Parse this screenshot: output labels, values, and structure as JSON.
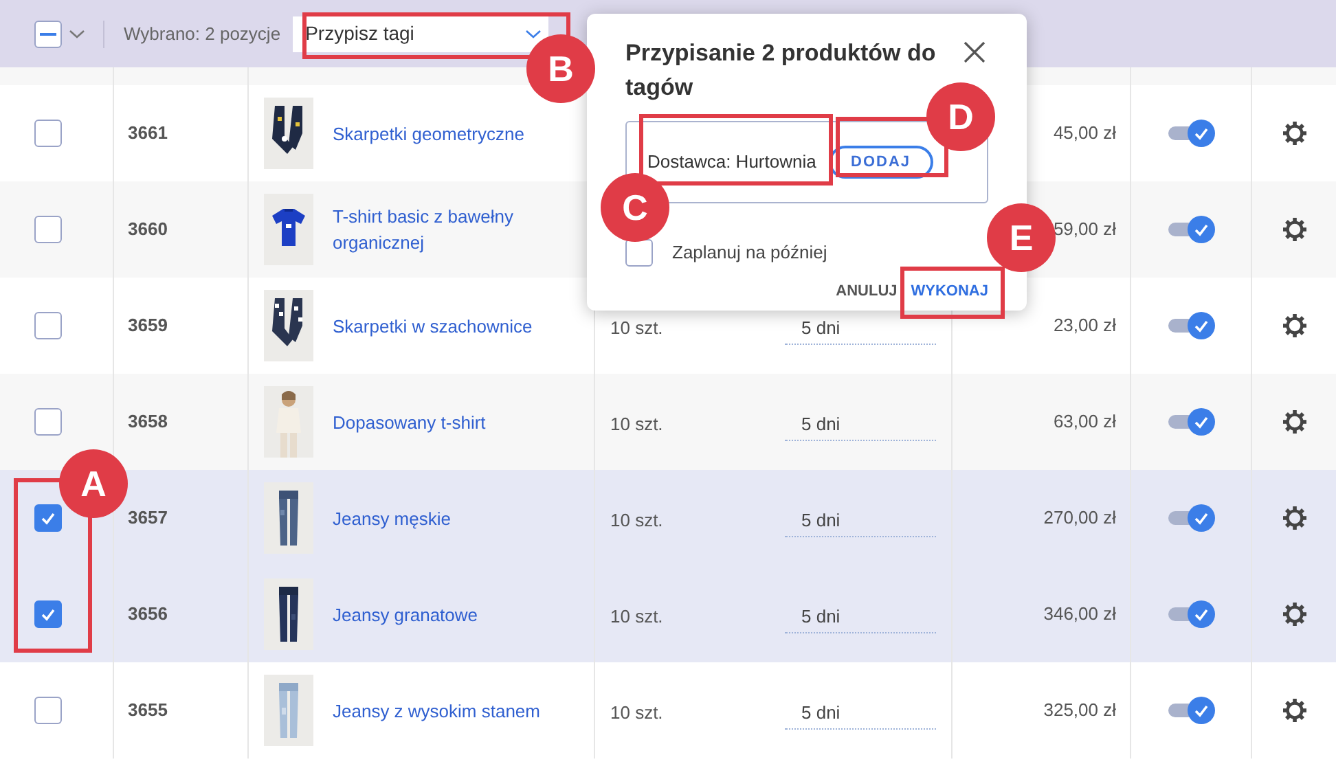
{
  "toolbar": {
    "select_all": {
      "indeterminate": true
    },
    "selection_text": "Wybrano: 2 pozycje",
    "action_select": {
      "value": "Przypisz tagi"
    }
  },
  "rows": [
    {
      "selected": false,
      "id": "3661",
      "name": "Skarpetki geometryczne",
      "price": "45,00 zł",
      "active": true
    },
    {
      "selected": false,
      "id": "3660",
      "name": "T-shirt basic z bawełny organicznej",
      "price": "59,00 zł",
      "active": true
    },
    {
      "selected": false,
      "id": "3659",
      "name": "Skarpetki w szachownice",
      "qty": "10 szt.",
      "days": "5 dni",
      "price": "23,00 zł",
      "active": true
    },
    {
      "selected": false,
      "id": "3658",
      "name": "Dopasowany t-shirt",
      "qty": "10 szt.",
      "days": "5 dni",
      "price": "63,00 zł",
      "active": true
    },
    {
      "selected": true,
      "id": "3657",
      "name": "Jeansy męskie",
      "qty": "10 szt.",
      "days": "5 dni",
      "price": "270,00 zł",
      "active": true
    },
    {
      "selected": true,
      "id": "3656",
      "name": "Jeansy granatowe",
      "qty": "10 szt.",
      "days": "5 dni",
      "price": "346,00 zł",
      "active": true
    },
    {
      "selected": false,
      "id": "3655",
      "name": "Jeansy z wysokim stanem",
      "qty": "10 szt.",
      "days": "5 dni",
      "price": "325,00 zł",
      "active": true
    }
  ],
  "dialog": {
    "title": "Przypisanie 2 produktów do tagów",
    "tag_input": {
      "value": "Dostawca: Hurtownia"
    },
    "add_button": "DODAJ",
    "schedule": {
      "label": "Zaplanuj na później",
      "checked": false
    },
    "cancel_button": "ANULUJ",
    "confirm_button": "WYKONAJ"
  },
  "annotations": [
    {
      "label": "A"
    },
    {
      "label": "B"
    },
    {
      "label": "C"
    },
    {
      "label": "D"
    },
    {
      "label": "E"
    }
  ]
}
